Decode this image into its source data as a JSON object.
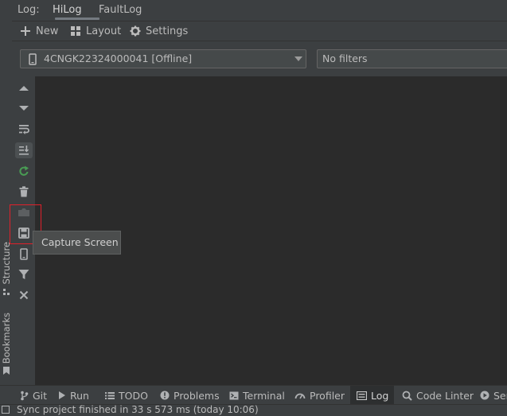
{
  "top_tabs": {
    "prefix": "Log:",
    "hilog": "HiLog",
    "faultlog": "FaultLog"
  },
  "toolbar": {
    "new_label": "New",
    "layout_label": "Layout",
    "settings_label": "Settings"
  },
  "filters": {
    "device_value": "4CNGK22324000041 [Offline]",
    "filter_value": "No filters"
  },
  "tooltip": {
    "text": "Capture Screen"
  },
  "side_tabs": {
    "structure": "Structure",
    "bookmarks": "Bookmarks"
  },
  "bottom_tabs": {
    "git": "Git",
    "run": "Run",
    "todo": "TODO",
    "problems": "Problems",
    "terminal": "Terminal",
    "profiler": "Profiler",
    "log": "Log",
    "code_linter": "Code Linter",
    "services": "Ser"
  },
  "status": {
    "message": "Sync project finished in 33 s 573 ms (today 10:06)"
  },
  "colors": {
    "background": "#3c3f41",
    "log_background": "#2b2b2b",
    "green_icon": "#499c54",
    "highlight_red": "#e0202a"
  }
}
